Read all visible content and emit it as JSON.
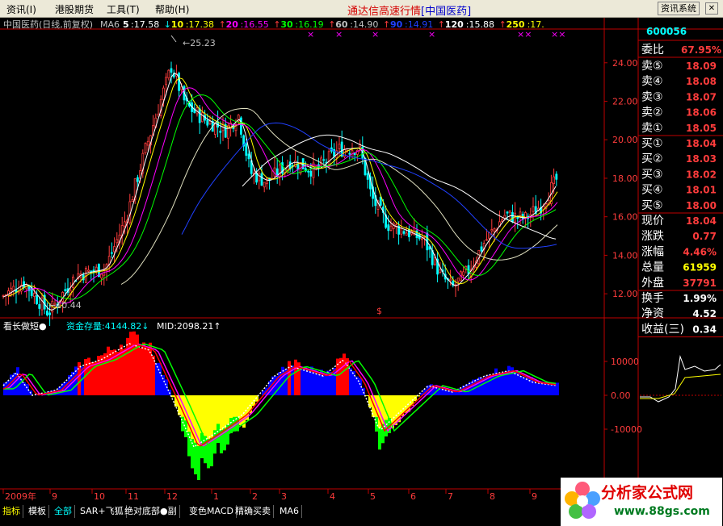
{
  "menubar": {
    "items": [
      "资讯(I)",
      "港股期货",
      "工具(T)",
      "帮助(H)"
    ],
    "title": "通达信高速行情",
    "title_bracket": "[中国医药]",
    "sys_button": "资讯系统"
  },
  "header": {
    "stock_label": "中国医药(日线,前复权)",
    "indicator": "MA6",
    "ma": [
      {
        "period": "5",
        "value": ":17.58",
        "arrow": "↓",
        "color": "#ffffff"
      },
      {
        "period": "10",
        "value": ":17.38",
        "arrow": "↑",
        "color": "#ffff00"
      },
      {
        "period": "20",
        "value": ":16.55",
        "arrow": "↑",
        "color": "#ff00ff"
      },
      {
        "period": "30",
        "value": ":16.19",
        "arrow": "↑",
        "color": "#00ff00"
      },
      {
        "period": "60",
        "value": ":14.90",
        "arrow": "↑",
        "color": "#c0c0c0"
      },
      {
        "period": "90",
        "value": ":14.91",
        "arrow": "↑",
        "color": "#2040ff"
      },
      {
        "period": "120",
        "value": ":15.88",
        "arrow": "↑",
        "color": "#ffffff"
      },
      {
        "period": "250",
        "value": ":17.",
        "arrow": "",
        "color": "#ffff00"
      }
    ]
  },
  "price_panel": {
    "y_labels": [
      "24.00",
      "22.00",
      "20.00",
      "18.00",
      "16.00",
      "14.00",
      "12.00"
    ],
    "high_label": "25.23",
    "low_label": "10.44",
    "dollar_mark": "$"
  },
  "indicator_panel": {
    "name": "看长做短",
    "fund_label": "资金存量:",
    "fund_value": "4144.82",
    "mid_label": "MID:",
    "mid_value": "2098.21",
    "y_labels": [
      "10000",
      "0.00",
      "-10000"
    ]
  },
  "x_axis": [
    "2009年",
    "9",
    "10",
    "11",
    "12",
    "1",
    "2",
    "3",
    "4",
    "5",
    "6",
    "7",
    "8",
    "9"
  ],
  "quote_panel": {
    "code": "600056",
    "wei_bi_label": "委比",
    "wei_bi": "67.95%",
    "sell": [
      {
        "label": "卖⑤",
        "price": "18.09"
      },
      {
        "label": "卖④",
        "price": "18.08"
      },
      {
        "label": "卖③",
        "price": "18.07"
      },
      {
        "label": "卖②",
        "price": "18.06"
      },
      {
        "label": "卖①",
        "price": "18.05"
      }
    ],
    "buy": [
      {
        "label": "买①",
        "price": "18.04"
      },
      {
        "label": "买②",
        "price": "18.03"
      },
      {
        "label": "买③",
        "price": "18.02"
      },
      {
        "label": "买④",
        "price": "18.01"
      },
      {
        "label": "买⑤",
        "price": "18.00"
      }
    ],
    "stats": [
      {
        "label": "现价",
        "value": "18.04",
        "color": "#ff3c3c"
      },
      {
        "label": "涨跌",
        "value": "0.77",
        "color": "#ff3c3c"
      },
      {
        "label": "涨幅",
        "value": "4.46%",
        "color": "#ff3c3c"
      },
      {
        "label": "总量",
        "value": "61959",
        "color": "#ffff00"
      },
      {
        "label": "外盘",
        "value": "37791",
        "color": "#ff3c3c"
      }
    ],
    "stats2": [
      {
        "label": "换手",
        "value": "1.99%",
        "color": "#ffffff"
      },
      {
        "label": "净资",
        "value": "4.52",
        "color": "#ffffff"
      },
      {
        "label": "收益(三)",
        "value": "0.34",
        "color": "#ffffff"
      }
    ]
  },
  "tabs": [
    {
      "label": "指标",
      "color": "#ffff00"
    },
    {
      "label": "模板",
      "color": "#ffffff"
    },
    {
      "label": "全部",
      "color": "#00ffff"
    },
    {
      "label": "SAR+飞狐",
      "color": "#ffffff"
    },
    {
      "label": "绝对底部●副",
      "color": "#ffffff"
    },
    {
      "label": "变色MACD",
      "color": "#ffffff"
    },
    {
      "label": "精确买卖",
      "color": "#ffffff"
    },
    {
      "label": "MA6",
      "color": "#ffffff"
    }
  ],
  "watermark": {
    "text": "分析家公式网",
    "url": "www.88gs.com"
  },
  "colors": {
    "up": "#ff3c3c",
    "down": "#00ffff",
    "grid": "#8b0000",
    "axis": "#c00000"
  }
}
